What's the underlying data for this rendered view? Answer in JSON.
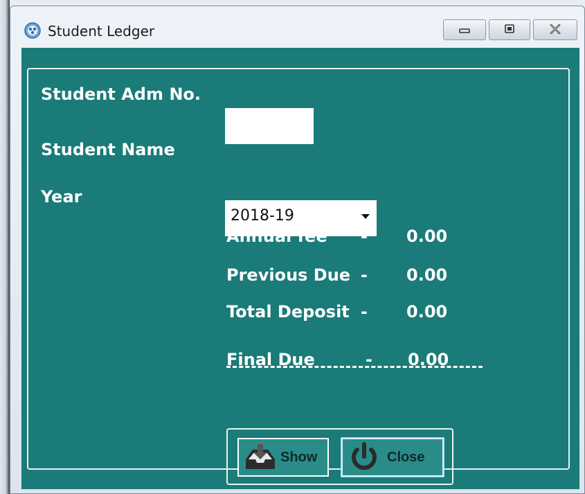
{
  "window": {
    "title": "Student Ledger",
    "minimize_icon": "minimize-icon",
    "maximize_icon": "maximize-icon",
    "close_icon": "close-icon"
  },
  "form": {
    "adm_no_label": "Student Adm No.",
    "adm_no_value": "",
    "student_name_label": "Student Name",
    "student_name_value": "",
    "year_label": "Year",
    "year_value": "2018-19"
  },
  "summary": {
    "annual_fee_label": "Annual fee",
    "annual_fee_dash": "-",
    "annual_fee_value": "0.00",
    "previous_due_label": "Previous Due",
    "previous_due_dash": "-",
    "previous_due_value": "0.00",
    "total_deposit_label": "Total Deposit",
    "total_deposit_dash": "-",
    "total_deposit_value": "0.00",
    "final_due_label": "Final Due",
    "final_due_dash": "-",
    "final_due_value": "0.00"
  },
  "buttons": {
    "show_label": "Show",
    "show_icon": "inbox-download-icon",
    "close_label": "Close",
    "close_icon": "power-icon"
  },
  "colors": {
    "client_bg": "#1a7b78",
    "text": "#ffffff"
  }
}
